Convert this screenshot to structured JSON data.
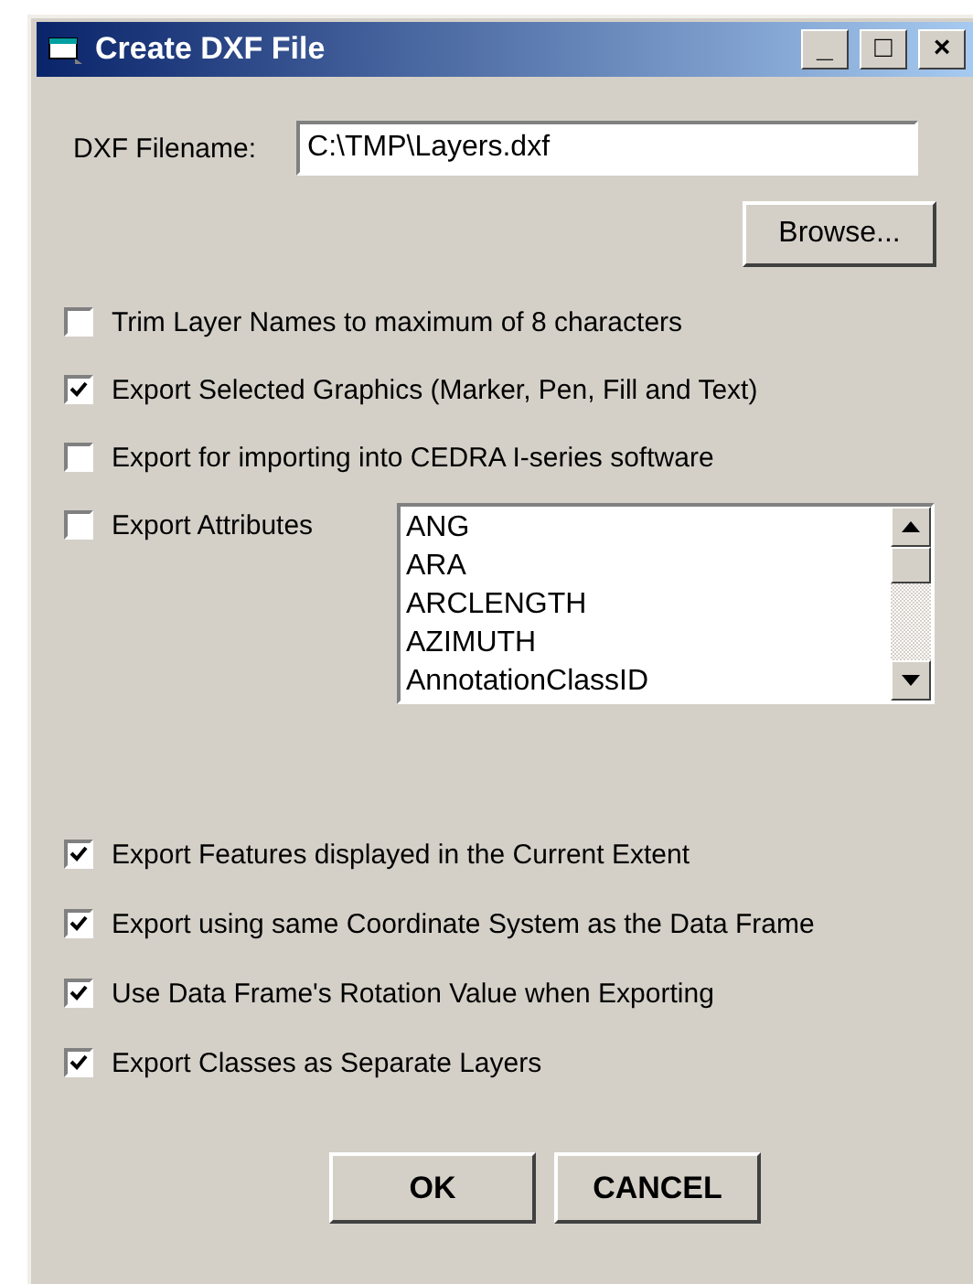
{
  "window": {
    "title": "Create DXF File",
    "controls": [
      "_",
      "□",
      "×"
    ]
  },
  "filename": {
    "label": "DXF Filename:",
    "value": "C:\\TMP\\Layers.dxf"
  },
  "browse_button": "Browse...",
  "options_top": [
    {
      "label": "Trim Layer Names to maximum of 8 characters",
      "checked": false
    },
    {
      "label": "Export Selected Graphics (Marker, Pen, Fill and Text)",
      "checked": true
    },
    {
      "label": "Export for importing into CEDRA I-series software",
      "checked": false
    }
  ],
  "attributes": {
    "label": "Export Attributes",
    "checked": false,
    "items": [
      "ANG",
      "ARA",
      "ARCLENGTH",
      "AZIMUTH",
      "AnnotationClassID"
    ]
  },
  "options_bottom": [
    {
      "label": "Export Features displayed in the Current Extent",
      "checked": true
    },
    {
      "label": "Export using same Coordinate System as the Data Frame",
      "checked": true
    },
    {
      "label": "Use Data Frame's Rotation Value when Exporting",
      "checked": true
    },
    {
      "label": "Export Classes as Separate Layers",
      "checked": true
    }
  ],
  "buttons": [
    "OK",
    "CANCEL"
  ]
}
